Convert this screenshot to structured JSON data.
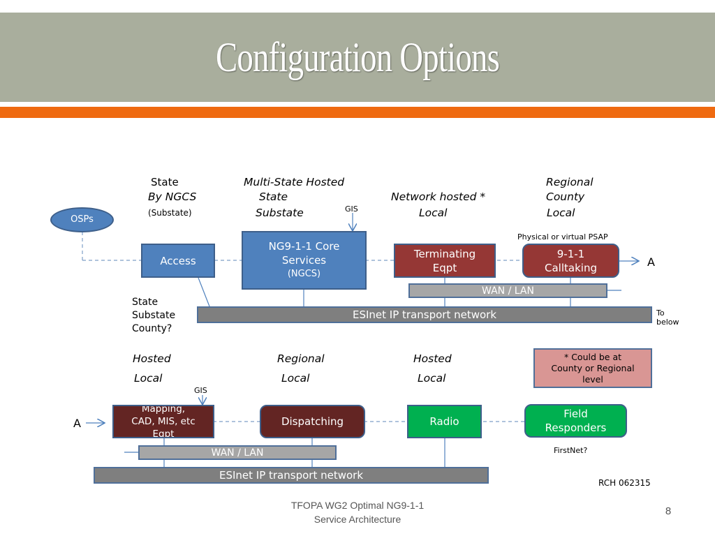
{
  "slide": {
    "title": "Configuration Options",
    "footer": {
      "line1": "TFOPA WG2 Optimal NG9-1-1",
      "line2": "Service Architecture"
    },
    "page_number": "8",
    "credit": "RCH 062315"
  },
  "colors": {
    "title_band": "#a9ae9d",
    "accent_bar": "#ef6a10",
    "blue_box": "#4f81bd",
    "maroon_box": "#953735",
    "dark_maroon_box": "#632523",
    "green_box": "#00b050",
    "wan_lan": "#a6a6a6",
    "esinet": "#7f7f7f",
    "note_box": "#d99694"
  },
  "top_section": {
    "column_labels": {
      "access": {
        "line1": "State",
        "line2": "By NGCS",
        "line3": "(Substate)"
      },
      "ngcs": {
        "line1": "Multi-State Hosted",
        "line2": "State",
        "line3": "Substate"
      },
      "terminating": {
        "line1": "Network hosted *",
        "line2": "Local"
      },
      "calltaking": {
        "line1": "Regional",
        "line2": "County",
        "line3": "Local"
      }
    },
    "gis_label": "GIS",
    "psap_label": "Physical or  virtual PSAP",
    "osps": "OSPs",
    "access": "Access",
    "ngcs": {
      "line1": "NG9-1-1 Core",
      "line2": "Services",
      "line3": "(NGCS)"
    },
    "terminating": {
      "line1": "Terminating",
      "line2": "Eqpt"
    },
    "calltaking": {
      "line1": "9-1-1",
      "line2": "Calltaking"
    },
    "connector_a": "A",
    "wan_lan": "WAN / LAN",
    "esinet": "ESInet IP transport network",
    "esinet_scope": {
      "line1": "State",
      "line2": "Substate",
      "line3": "County?"
    },
    "to_below": {
      "line1": "To",
      "line2": "below"
    }
  },
  "bottom_section": {
    "column_labels": {
      "mapping": {
        "line1": "Hosted",
        "line2": "Local"
      },
      "dispatching": {
        "line1": "Regional",
        "line2": "Local"
      },
      "radio": {
        "line1": "Hosted",
        "line2": "Local"
      }
    },
    "note": {
      "line1": "* Could be  at",
      "line2": "County or Regional",
      "line3": "level"
    },
    "gis_label": "GIS",
    "connector_a": "A",
    "mapping": {
      "line1": "Mapping,",
      "line2": "CAD, MIS, etc",
      "line3": "Eqpt"
    },
    "dispatching": "Dispatching",
    "radio": "Radio",
    "field_responders": {
      "line1": "Field",
      "line2": "Responders"
    },
    "firstnet": "FirstNet?",
    "wan_lan": "WAN / LAN",
    "esinet": "ESInet IP transport network"
  }
}
